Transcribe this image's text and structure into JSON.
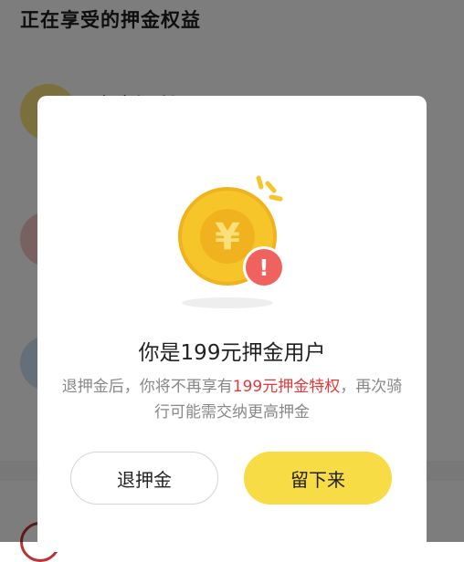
{
  "background": {
    "title": "正在享受的押金权益",
    "benefit_label_partial": "专享福利"
  },
  "dialog": {
    "title": "你是199元押金用户",
    "body_before": "退押金后，你将不再享有",
    "body_highlight": "199元押金特权",
    "body_after": "，再次骑行可能需交纳更高押金",
    "refund_button": "退押金",
    "stay_button": "留下来",
    "coin_symbol": "¥",
    "alert_symbol": "!"
  },
  "colors": {
    "accent_yellow": "#f7dc45",
    "highlight_red": "#e4393c",
    "coin_gold": "#f5c52a",
    "alert_red": "#f0625d"
  }
}
